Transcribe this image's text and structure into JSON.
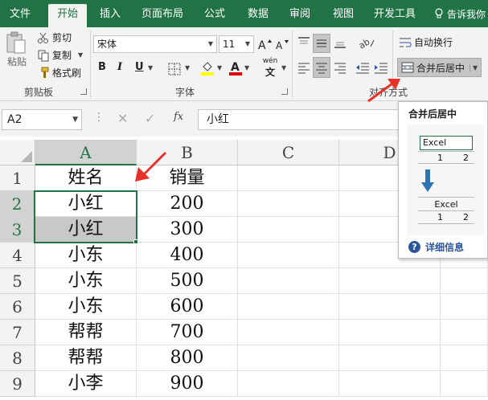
{
  "tabs": [
    {
      "label": "文件",
      "active": false
    },
    {
      "label": "开始",
      "active": true
    },
    {
      "label": "插入",
      "active": false
    },
    {
      "label": "页面布局",
      "active": false
    },
    {
      "label": "公式",
      "active": false
    },
    {
      "label": "数据",
      "active": false
    },
    {
      "label": "审阅",
      "active": false
    },
    {
      "label": "视图",
      "active": false
    },
    {
      "label": "开发工具",
      "active": false
    }
  ],
  "tell_me": "告诉我你",
  "clipboard": {
    "paste": "粘贴",
    "cut": "剪切",
    "copy": "复制",
    "format_painter": "格式刷",
    "group_label": "剪贴板"
  },
  "font": {
    "name": "宋体",
    "size": "11",
    "bold": "B",
    "italic": "I",
    "underline": "U",
    "phonetic": "wén",
    "group_label": "字体"
  },
  "alignment": {
    "wrap_text": "自动换行",
    "merge_center": "合并后居中",
    "group_label": "对齐方式"
  },
  "formula_bar": {
    "name_box": "A2",
    "fx": "fx",
    "content": "小红"
  },
  "columns": [
    "A",
    "B",
    "C",
    "D"
  ],
  "rows": [
    {
      "num": "1",
      "a": "姓名",
      "b": "销量"
    },
    {
      "num": "2",
      "a": "小红",
      "b": "200"
    },
    {
      "num": "3",
      "a": "小红",
      "b": "300"
    },
    {
      "num": "4",
      "a": "小东",
      "b": "400"
    },
    {
      "num": "5",
      "a": "小东",
      "b": "500"
    },
    {
      "num": "6",
      "a": "小东",
      "b": "600"
    },
    {
      "num": "7",
      "a": "帮帮",
      "b": "700"
    },
    {
      "num": "8",
      "a": "帮帮",
      "b": "800"
    },
    {
      "num": "9",
      "a": "小李",
      "b": "900"
    }
  ],
  "tooltip": {
    "title": "合并后居中",
    "example_text": "Excel",
    "example_1": "1",
    "example_2": "2",
    "help": "详细信息"
  },
  "colors": {
    "accent": "#217346",
    "annotation": "#e8312a",
    "help_blue": "#2b579a"
  }
}
